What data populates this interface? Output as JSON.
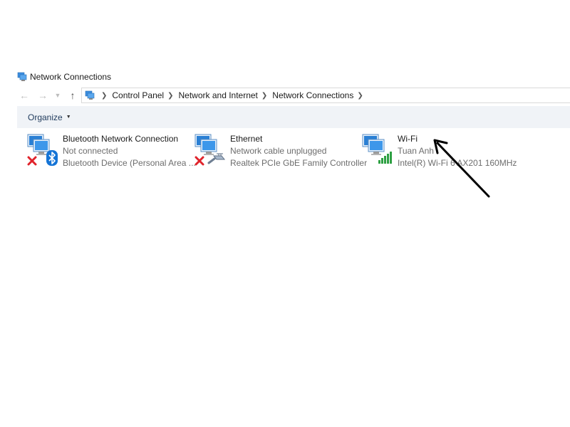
{
  "window": {
    "title": "Network Connections",
    "icon": "network-connections-icon"
  },
  "navigation": {
    "back_icon": "arrow-left-icon",
    "forward_icon": "arrow-right-icon",
    "recent_icon": "chevron-down-icon",
    "up_icon": "arrow-up-icon",
    "breadcrumbs": [
      "Control Panel",
      "Network and Internet",
      "Network Connections"
    ]
  },
  "command_bar": {
    "organize_label": "Organize"
  },
  "connections": [
    {
      "name": "Bluetooth Network Connection",
      "status": "Not connected",
      "device": "Bluetooth Device (Personal Area ...",
      "icon": "bluetooth-connection-icon",
      "badge": "disconnected-x-icon"
    },
    {
      "name": "Ethernet",
      "status": "Network cable unplugged",
      "device": "Realtek PCIe GbE Family Controller",
      "icon": "ethernet-connection-icon",
      "badge": "disconnected-x-icon"
    },
    {
      "name": "Wi-Fi",
      "status": "Tuan Anh",
      "device": "Intel(R) Wi-Fi 6 AX201 160MHz",
      "icon": "wifi-connection-icon",
      "badge": "signal-bars-icon"
    }
  ],
  "colors": {
    "command_bar_bg": "#f0f3f7",
    "monitor_blue": "#2a7fd4",
    "error_red": "#e0232b",
    "signal_green": "#2ea043",
    "bluetooth_blue": "#1474d6"
  }
}
